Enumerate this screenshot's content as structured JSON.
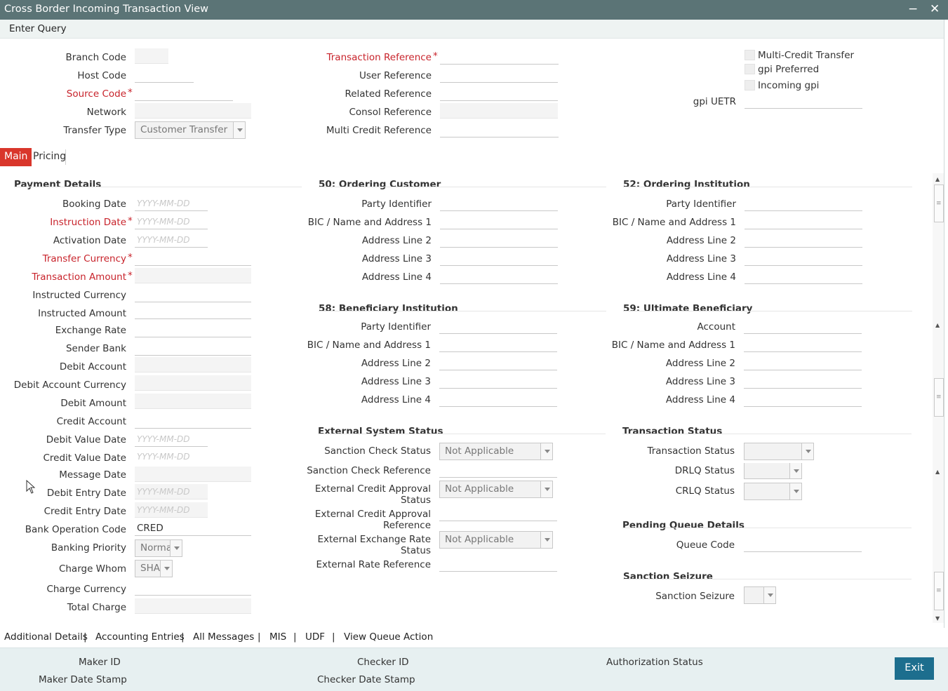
{
  "window": {
    "title": "Cross Border Incoming Transaction View",
    "minimize_icon": "minus-icon",
    "close_icon": "close-icon"
  },
  "menu": {
    "enter_query": "Enter Query"
  },
  "header": {
    "branch_code": "Branch Code",
    "host_code": "Host Code",
    "source_code": "Source Code",
    "network": "Network",
    "transfer_type": "Transfer Type",
    "transfer_type_value": "Customer Transfer",
    "transaction_reference": "Transaction Reference",
    "user_reference": "User Reference",
    "related_reference": "Related Reference",
    "consol_reference": "Consol Reference",
    "multi_credit_reference": "Multi Credit Reference",
    "multi_credit_transfer": "Multi-Credit Transfer",
    "gpi_preferred": "gpi Preferred",
    "incoming_gpi": "Incoming gpi",
    "gpi_uetr": "gpi UETR",
    "required_marker": "*"
  },
  "tabs": {
    "main": "Main",
    "pricing": "Pricing"
  },
  "payment_details": {
    "title": "Payment Details",
    "date_placeholder": "YYYY-MM-DD",
    "booking_date": "Booking Date",
    "instruction_date": "Instruction Date",
    "activation_date": "Activation Date",
    "transfer_currency": "Transfer Currency",
    "transaction_amount": "Transaction Amount",
    "instructed_currency": "Instructed Currency",
    "instructed_amount": "Instructed Amount",
    "exchange_rate": "Exchange Rate",
    "sender_bank": "Sender Bank",
    "debit_account": "Debit Account",
    "debit_account_currency": "Debit Account Currency",
    "debit_amount": "Debit Amount",
    "credit_account": "Credit Account",
    "debit_value_date": "Debit Value Date",
    "credit_value_date": "Credit Value Date",
    "message_date": "Message Date",
    "debit_entry_date": "Debit Entry Date",
    "credit_entry_date": "Credit Entry Date",
    "bank_operation_code": "Bank Operation Code",
    "bank_operation_code_value": "CRED",
    "banking_priority": "Banking Priority",
    "banking_priority_value": "Normal",
    "charge_whom": "Charge Whom",
    "charge_whom_value": "SHA",
    "charge_currency": "Charge Currency",
    "total_charge": "Total Charge"
  },
  "ordering_customer": {
    "title": "50: Ordering Customer",
    "party_identifier": "Party Identifier",
    "bic_name_address_1": "BIC / Name and Address 1",
    "address_line_2": "Address Line 2",
    "address_line_3": "Address Line 3",
    "address_line_4": "Address Line 4"
  },
  "ordering_institution": {
    "title": "52: Ordering Institution",
    "party_identifier": "Party Identifier",
    "bic_name_address_1": "BIC / Name and Address 1",
    "address_line_2": "Address Line 2",
    "address_line_3": "Address Line 3",
    "address_line_4": "Address Line 4"
  },
  "beneficiary_institution": {
    "title": "58: Beneficiary Institution",
    "party_identifier": "Party Identifier",
    "bic_name_address_1": "BIC / Name and Address 1",
    "address_line_2": "Address Line 2",
    "address_line_3": "Address Line 3",
    "address_line_4": "Address Line 4"
  },
  "ultimate_beneficiary": {
    "title": "59: Ultimate Beneficiary",
    "account": "Account",
    "bic_name_address_1": "BIC / Name and Address 1",
    "address_line_2": "Address Line 2",
    "address_line_3": "Address Line 3",
    "address_line_4": "Address Line 4"
  },
  "external_system_status": {
    "title": "External System Status",
    "sanction_check_status": "Sanction Check Status",
    "sanction_check_status_value": "Not Applicable",
    "sanction_check_reference": "Sanction Check Reference",
    "external_credit_approval_status": "External Credit Approval Status",
    "external_credit_approval_status_value": "Not Applicable",
    "external_credit_approval_reference": "External Credit Approval Reference",
    "external_exchange_rate_status": "External Exchange Rate Status",
    "external_exchange_rate_status_value": "Not Applicable",
    "external_rate_reference": "External Rate Reference"
  },
  "transaction_status": {
    "title": "Transaction Status",
    "transaction_status": "Transaction Status",
    "drlq_status": "DRLQ Status",
    "crlq_status": "CRLQ Status"
  },
  "pending_queue": {
    "title": "Pending Queue Details",
    "queue_code": "Queue Code"
  },
  "sanction_seizure": {
    "title": "Sanction Seizure",
    "sanction_seizure": "Sanction Seizure"
  },
  "bottom_links": {
    "additional_details": "Additional Details",
    "accounting_entries": "Accounting Entries",
    "all_messages": "All Messages",
    "mis": "MIS",
    "udf": "UDF",
    "view_queue_action": "View Queue Action",
    "separator": "|"
  },
  "footer": {
    "maker_id": "Maker ID",
    "maker_date_stamp": "Maker Date Stamp",
    "checker_id": "Checker ID",
    "checker_date_stamp": "Checker Date Stamp",
    "authorization_status": "Authorization Status",
    "exit": "Exit"
  },
  "colors": {
    "title_bar": "#5b7476",
    "required": "#c8232b",
    "active_tab": "#d9362b",
    "exit_button": "#1d6e8e",
    "footer_bg": "#e7f0f1"
  }
}
